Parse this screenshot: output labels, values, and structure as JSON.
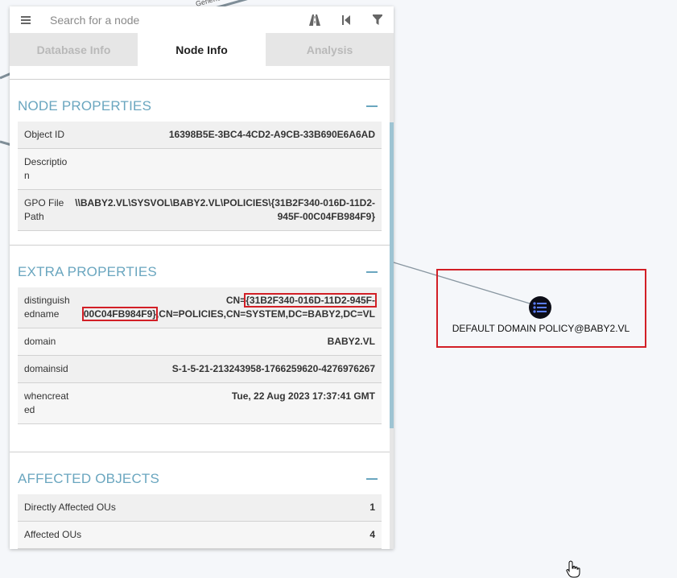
{
  "search": {
    "placeholder": "Search for a node"
  },
  "tabs": [
    {
      "label": "Database Info",
      "active": false
    },
    {
      "label": "Node Info",
      "active": true
    },
    {
      "label": "Analysis",
      "active": false
    }
  ],
  "node_properties": {
    "title": "NODE PROPERTIES",
    "rows": [
      {
        "label": "Object ID",
        "value": "16398B5E-3BC4-4CD2-A9CB-33B690E6A6AD"
      },
      {
        "label": "Description",
        "value": ""
      },
      {
        "label": "GPO File Path",
        "value": "\\\\BABY2.VL\\SYSVOL\\BABY2.VL\\POLICIES\\{31B2F340-016D-11D2-945F-00C04FB984F9}"
      }
    ]
  },
  "extra_properties": {
    "title": "EXTRA PROPERTIES",
    "rows": [
      {
        "label": "distinguishedname",
        "value_prefix": "CN=",
        "value_hl1": "{31B2F340-016D-11D2-945F-",
        "value_hl2": "00C04FB984F9}",
        "value_suffix": ",CN=POLICIES,CN=SYSTEM,DC=BABY2,DC=VL"
      },
      {
        "label": "domain",
        "value": "BABY2.VL"
      },
      {
        "label": "domainsid",
        "value": "S-1-5-21-213243958-1766259620-4276976267"
      },
      {
        "label": "whencreated",
        "value": "Tue, 22 Aug 2023 17:37:41 GMT"
      }
    ]
  },
  "affected_objects": {
    "title": "AFFECTED OBJECTS",
    "rows": [
      {
        "label": "Directly Affected OUs",
        "value": "1"
      },
      {
        "label": "Affected OUs",
        "value": "4"
      }
    ]
  },
  "graph": {
    "node_label": "DEFAULT DOMAIN POLICY@BABY2.VL",
    "edge_label_fragment": "GenericAll",
    "node_icon": "list-icon",
    "highlight_color": "#d21f26",
    "accent_color": "#6aa6bf"
  }
}
